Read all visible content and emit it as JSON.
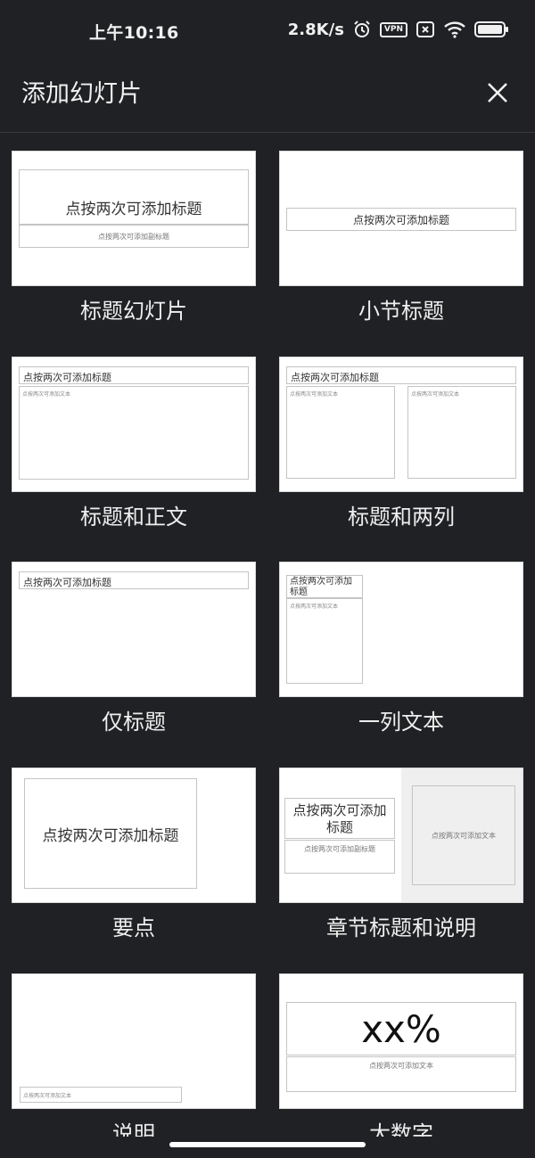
{
  "status_bar": {
    "time": "上午10:16",
    "net_speed": "2.8K/s",
    "vpn_label": "VPN",
    "icons": [
      "alarm-icon",
      "vpn-icon",
      "sim-no-service-icon",
      "wifi-icon",
      "battery-icon"
    ]
  },
  "app_bar": {
    "title": "添加幻灯片",
    "close_icon": "close-icon"
  },
  "placeholders": {
    "title": "点按两次可添加标题",
    "subtitle": "点按两次可添加副标题",
    "text": "点按两次可添加文本",
    "title_line1": "点按两次可添加",
    "title_line2": "标题",
    "big_number": "xx%"
  },
  "layouts": [
    {
      "name": "标题幻灯片"
    },
    {
      "name": "小节标题"
    },
    {
      "name": "标题和正文"
    },
    {
      "name": "标题和两列"
    },
    {
      "name": "仅标题"
    },
    {
      "name": "一列文本"
    },
    {
      "name": "要点"
    },
    {
      "name": "章节标题和说明"
    },
    {
      "name": "说明"
    },
    {
      "name": "大数字"
    }
  ],
  "colors": {
    "background": "#202124",
    "thumbnail": "#ffffff",
    "text": "#e8eaed",
    "section_panel": "#efefef"
  }
}
